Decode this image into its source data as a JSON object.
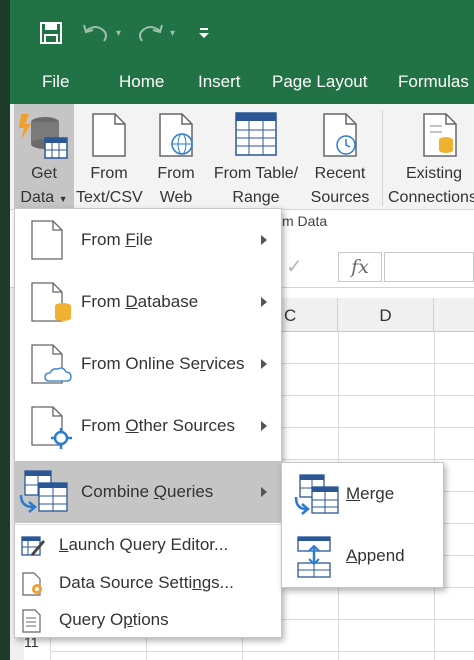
{
  "qat": {
    "dropdown_glyph": "▾"
  },
  "tabs": [
    {
      "label": "File"
    },
    {
      "label": "Home"
    },
    {
      "label": "Insert"
    },
    {
      "label": "Page Layout"
    },
    {
      "label": "Formulas"
    }
  ],
  "ribbon": {
    "get_data": {
      "line1": "Get",
      "line2": "Data"
    },
    "from_text_csv": {
      "line1": "From",
      "line2": "Text/CSV"
    },
    "from_web": {
      "line1": "From",
      "line2": "Web"
    },
    "from_table": {
      "line1": "From Table/",
      "line2": "Range"
    },
    "recent_sources": {
      "line1": "Recent",
      "line2": "Sources"
    },
    "existing_connections": {
      "line1": "Existing",
      "line2": "Connections"
    },
    "group_label": "m Data"
  },
  "formula_bar": {
    "fx": "fx",
    "check": "✓"
  },
  "columns": [
    "C",
    "D"
  ],
  "rows": {
    "last": "11"
  },
  "menu": {
    "items": [
      {
        "pre": "From ",
        "u": "F",
        "post": "ile"
      },
      {
        "pre": "From ",
        "u": "D",
        "post": "atabase"
      },
      {
        "pre": "From Online Se",
        "u": "r",
        "post": "vices"
      },
      {
        "pre": "From ",
        "u": "O",
        "post": "ther Sources"
      },
      {
        "pre": "Combine ",
        "u": "Q",
        "post": "ueries"
      }
    ],
    "simple": [
      {
        "pre": "",
        "u": "L",
        "post": "aunch Query Editor..."
      },
      {
        "pre": "Data Source Setti",
        "u": "n",
        "post": "gs..."
      },
      {
        "pre": "Query O",
        "u": "p",
        "post": "tions"
      }
    ]
  },
  "submenu": [
    {
      "pre": "",
      "u": "M",
      "post": "erge"
    },
    {
      "pre": "",
      "u": "A",
      "post": "ppend"
    }
  ]
}
